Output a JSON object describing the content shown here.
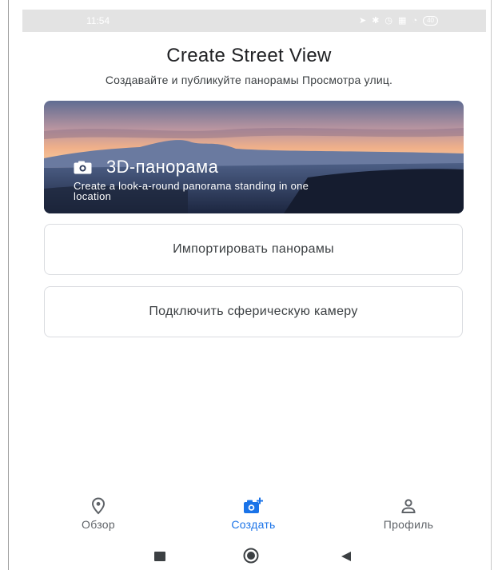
{
  "status_bar": {
    "time": "11:54",
    "icons": [
      "location-arrow-icon",
      "bluetooth-icon",
      "alarm-icon",
      "signal-icon",
      "wifi-icon",
      "battery-icon"
    ],
    "battery_label": "40"
  },
  "header": {
    "title": "Create Street View",
    "subtitle": "Создавайте и публикуйте панорамы Просмотра улиц."
  },
  "hero_card": {
    "title": "3D-панорама",
    "description": "Create a look-a-round panorama standing in one location",
    "icon": "camera-icon"
  },
  "options": {
    "import_label": "Импортировать панорамы",
    "connect_label": "Подключить сферическую камеру"
  },
  "bottom_nav": {
    "items": [
      {
        "label": "Обзор",
        "icon": "location-pin-icon",
        "active": false
      },
      {
        "label": "Создать",
        "icon": "add-photo-icon",
        "active": true
      },
      {
        "label": "Профиль",
        "icon": "person-icon",
        "active": false
      }
    ],
    "active_color": "#1a73e8",
    "inactive_color": "#5f6368"
  },
  "system_nav": {
    "buttons": [
      "recents-square-icon",
      "home-circle-icon",
      "back-triangle-icon"
    ]
  }
}
